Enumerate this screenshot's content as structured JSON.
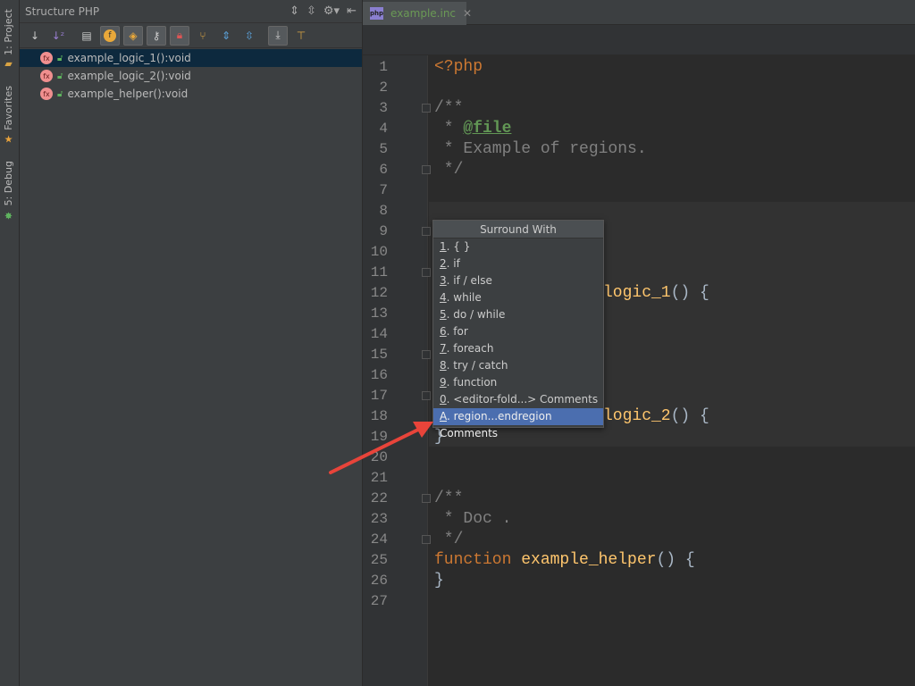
{
  "side_strip": [
    {
      "label": "1: Project",
      "icon": "folder-icon"
    },
    {
      "label": "Favorites",
      "icon": "star-icon"
    },
    {
      "label": "5: Debug",
      "icon": "bug-icon"
    }
  ],
  "structure": {
    "title": "Structure PHP",
    "items": [
      {
        "label": "example_logic_1():void",
        "selected": true
      },
      {
        "label": "example_logic_2():void"
      },
      {
        "label": "example_helper():void"
      }
    ]
  },
  "editor": {
    "tab": "example.inc",
    "tab_icon": "php",
    "line_numbers": [
      "1",
      "2",
      "3",
      "4",
      "5",
      "6",
      "7",
      "8",
      "9",
      "10",
      "11",
      "12",
      "13",
      "14",
      "15",
      "16",
      "17",
      "18",
      "19",
      "20",
      "21",
      "22",
      "23",
      "24",
      "25",
      "26",
      "27"
    ],
    "code": {
      "l1": "<?php",
      "l3": "/**",
      "l4_star": " * ",
      "l4_tag": "@file",
      "l5": " * Example of regions.",
      "l6": " */",
      "l12_name": "logic_1",
      "l12_rest": "() {",
      "l18_name": "logic_2",
      "l18_rest": "() {",
      "l19": "}",
      "l22": "/**",
      "l23": " * Doc .",
      "l24": " */",
      "l25_kw": "function ",
      "l25_name": "example_helper",
      "l25_rest": "() {",
      "l26": "}"
    }
  },
  "popup": {
    "title": "Surround With",
    "items": [
      {
        "key": "1",
        "label": ". { }"
      },
      {
        "key": "2",
        "label": ". if"
      },
      {
        "key": "3",
        "label": ". if / else"
      },
      {
        "key": "4",
        "label": ". while"
      },
      {
        "key": "5",
        "label": ". do / while"
      },
      {
        "key": "6",
        "label": ". for"
      },
      {
        "key": "7",
        "label": ". foreach"
      },
      {
        "key": "8",
        "label": ". try / catch"
      },
      {
        "key": "9",
        "label": ". function"
      },
      {
        "key": "0",
        "label": ". <editor-fold...> Comments"
      },
      {
        "key": "A",
        "label": ". region...endregion Comments",
        "selected": true
      }
    ]
  },
  "colors": {
    "keyword": "#cc7832",
    "function": "#ffc66d",
    "comment": "#808080",
    "doctag": "#629755",
    "selection": "#4b6eaf",
    "arrow": "#e8443a"
  }
}
